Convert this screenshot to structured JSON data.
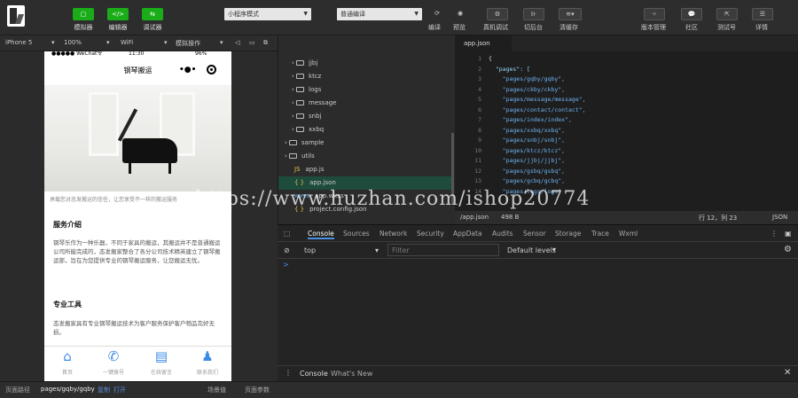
{
  "toolbar": {
    "simulator": "模拟器",
    "editor": "编辑器",
    "debugger": "调试器",
    "mode_select": "小程序模式",
    "compile_select": "普通编译",
    "compile": "编译",
    "preview": "预览",
    "remote_debug": "真机调试",
    "backend": "切后台",
    "cache": "清缓存",
    "version": "版本管理",
    "community": "社区",
    "test": "测试号",
    "detail": "详情"
  },
  "subbar": {
    "device": "iPhone 5",
    "zoom": "100%",
    "network": "WiFi",
    "sim_op": "模拟操作"
  },
  "phone": {
    "status_left": "●●●●● WeChat令",
    "status_time": "11:30",
    "status_battery": "96%",
    "title": "钢琴搬运",
    "caption": "承载您对态发搬运的信任，让您享受不一样的搬运服务",
    "section1_title": "服务介绍",
    "section1_text": "钢琴乐作为一种乐器，不同于家具的搬运，其搬运并不是普通搬运公司所能完成的，态发搬家整合了各分公司技术精英建立了钢琴搬运部，旨在为您提供专业的钢琴搬运服务，让您搬运无忧。",
    "section2_title": "专业工具",
    "section2_text": "态发搬家具有专业钢琴搬运技术为客户服务保护客户物品完好无损。",
    "tabs": [
      {
        "label": "首页",
        "icon": "home-icon"
      },
      {
        "label": "一键拨号",
        "icon": "phone-icon"
      },
      {
        "label": "在线留言",
        "icon": "message-icon"
      },
      {
        "label": "联系我们",
        "icon": "contact-icon"
      }
    ]
  },
  "tree": {
    "items": [
      "jjbj",
      "ktcz",
      "logs",
      "message",
      "snbj",
      "xxbq",
      "sample",
      "utils",
      "app.js",
      "app.json",
      "app.wxss",
      "project.config.json"
    ]
  },
  "editor": {
    "tab": "app.json",
    "lines": [
      "1",
      "2",
      "3",
      "4",
      "5",
      "6",
      "7",
      "8",
      "9",
      "10",
      "11",
      "12",
      "13",
      "14"
    ],
    "code": [
      "{",
      "  \"pages\": [",
      "    \"pages/gqby/gqby\",",
      "    \"pages/ckby/ckby\",",
      "    \"pages/message/message\",",
      "    \"pages/contact/contact\",",
      "    \"pages/index/index\",",
      "    \"pages/xxbq/xxbq\",",
      "    \"pages/snbj/snbj\",",
      "    \"pages/ktcz/ktcz\",",
      "    \"pages/jjbj/jjbj\",",
      "    \"pages/gsbq/gsbq\",",
      "    \"pages/gcbq/gcbq\",",
      "    \"pages/logs/logs\""
    ]
  },
  "statusbar": {
    "file": "/app.json",
    "size": "498 B",
    "position": "行 12，列 23",
    "lang": "JSON"
  },
  "devtools": {
    "tabs": [
      "Console",
      "Sources",
      "Network",
      "Security",
      "AppData",
      "Audits",
      "Sensor",
      "Storage",
      "Trace",
      "Wxml"
    ],
    "context": "top",
    "filter_placeholder": "Filter",
    "levels": "Default levels",
    "prompt": ">",
    "drawer_console": "Console",
    "drawer_whatsnew": "What's New"
  },
  "bottombar": {
    "path_label": "页面路径",
    "path": "pages/gqby/gqby",
    "copy": "复制",
    "open": "打开",
    "scene": "场景值",
    "params": "页面参数"
  },
  "watermark": "https://www.huzhan.com/ishop20774"
}
